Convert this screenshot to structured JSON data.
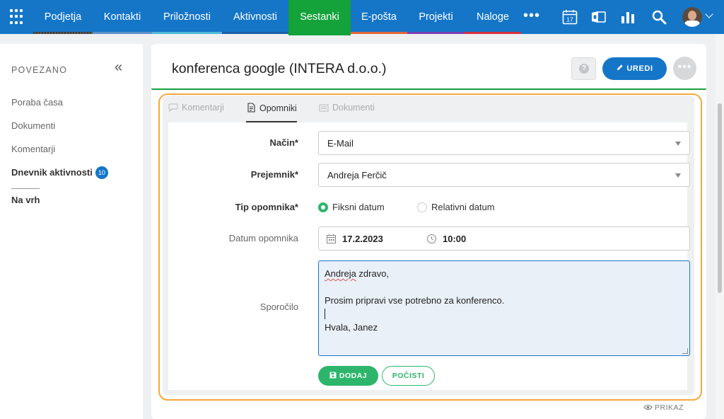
{
  "nav": {
    "items": [
      {
        "label": "Podjetja",
        "bar": "#4a4a4a"
      },
      {
        "label": "Kontakti",
        "bar": "#5d8fc9"
      },
      {
        "label": "Priložnosti",
        "bar": "#4fb6d8"
      },
      {
        "label": "Aktivnosti",
        "bar": "#1e5fa8"
      },
      {
        "label": "Sestanki",
        "bar": "#14a23a"
      },
      {
        "label": "E-pošta",
        "bar": "#e0663a"
      },
      {
        "label": "Projekti",
        "bar": "#7b3fb0"
      },
      {
        "label": "Naloge",
        "bar": "#d62f3c"
      }
    ],
    "active": "Sestanki",
    "more": "•••",
    "calendar_day": "17",
    "icons": [
      "apps-grid-icon",
      "calendar-icon",
      "outlook-sync-icon",
      "reports-icon",
      "search-icon",
      "avatar",
      "chevron-down-icon"
    ]
  },
  "sidebar": {
    "title": "POVEZANO",
    "collapse_glyph": "«",
    "links": [
      "Poraba časa",
      "Dokumenti",
      "Komentarji"
    ],
    "activity_log": "Dnevnik aktivnosti",
    "activity_count": "10",
    "to_top": "Na vrh"
  },
  "header": {
    "title": "konferenca google (INTERA d.o.o.)",
    "help_glyph": "?",
    "edit_label": "UREDI",
    "more_glyph": "•••"
  },
  "tabs": [
    {
      "label": "Komentarji",
      "icon": "comment-icon"
    },
    {
      "label": "Opomniki",
      "icon": "document-icon"
    },
    {
      "label": "Dokumenti",
      "icon": "files-icon"
    }
  ],
  "active_tab": "Opomniki",
  "form": {
    "method_label": "Način*",
    "method_value": "E-Mail",
    "recipient_label": "Prejemnik*",
    "recipient_value": "Andreja Ferčič",
    "type_label": "Tip opomnika*",
    "type_option_fixed": "Fiksni datum",
    "type_option_relative": "Relativni datum",
    "type_selected": "Fiksni datum",
    "date_label": "Datum opomnika",
    "date_value": "17.2.2023",
    "time_value": "10:00",
    "message_label": "Sporočilo",
    "message_greeting_name": "Andreja",
    "message_greeting_rest": " zdravo,",
    "message_body": "Prosim pripravi vse potrebno za konferenco.",
    "message_signoff": "Hvala, Janez",
    "add_label": "DODAJ",
    "clear_label": "POČISTI"
  },
  "footer": {
    "view_label": "PRIKAZ"
  },
  "colors": {
    "brand_blue": "#1576c8",
    "active_green": "#14a23a",
    "action_green": "#2db66b",
    "highlight_orange": "#f5a93a"
  }
}
